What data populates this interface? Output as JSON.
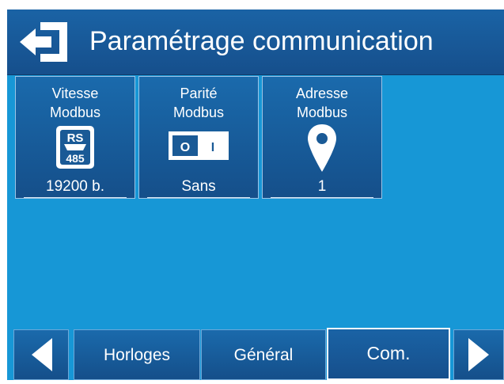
{
  "header": {
    "title": "Paramétrage communication",
    "back_icon": "exit-arrow-icon"
  },
  "tiles": [
    {
      "line1": "Vitesse",
      "line2": "Modbus",
      "icon": "rs485-icon",
      "icon_text_top": "RS",
      "icon_text_bottom": "485",
      "value": "19200 b."
    },
    {
      "line1": "Parité",
      "line2": "Modbus",
      "icon": "switch-icon",
      "switch_off": "O",
      "switch_on": "I",
      "value": "Sans"
    },
    {
      "line1": "Adresse",
      "line2": "Modbus",
      "icon": "location-pin-icon",
      "value": "1"
    }
  ],
  "footer": {
    "prev_icon": "triangle-left-icon",
    "next_icon": "triangle-right-icon",
    "tabs": [
      {
        "label": "Horloges",
        "active": false
      },
      {
        "label": "Général",
        "active": false
      },
      {
        "label": "Com.",
        "active": true
      }
    ]
  },
  "colors": {
    "background": "#1797d6",
    "panel": "#1a63a5",
    "text": "#ffffff"
  }
}
